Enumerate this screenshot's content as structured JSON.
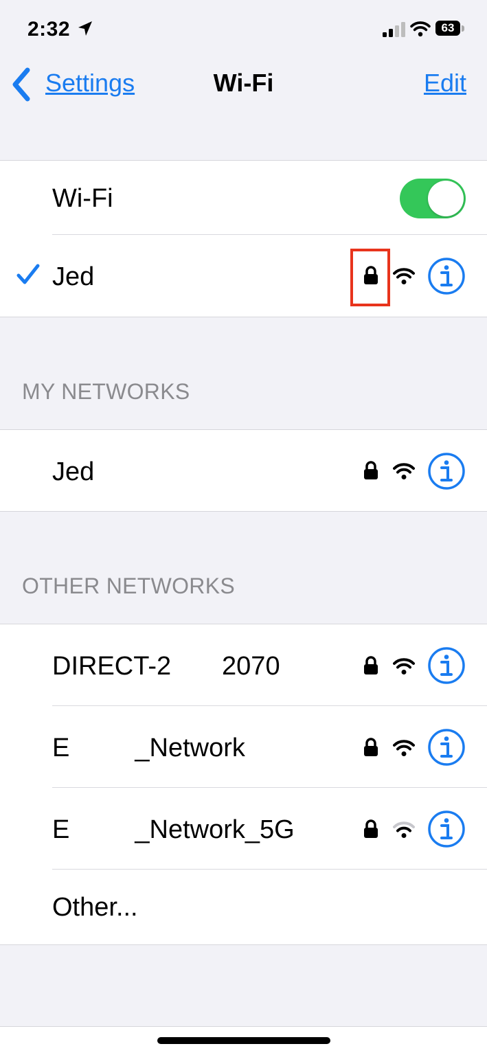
{
  "status_bar": {
    "time": "2:32",
    "battery": "63",
    "icons": [
      "location-arrow-icon",
      "cellular-signal-icon",
      "wifi-icon",
      "battery-icon"
    ]
  },
  "nav": {
    "back_label": "Settings",
    "title": "Wi-Fi",
    "edit_label": "Edit"
  },
  "wifi_toggle": {
    "label": "Wi-Fi",
    "on": true,
    "color": "#34c759"
  },
  "connected_network": {
    "name": "Jed",
    "secured": true,
    "signal": "full"
  },
  "my_networks": {
    "header": "MY NETWORKS",
    "items": [
      {
        "name": "Jed",
        "secured": true,
        "signal": "full"
      }
    ]
  },
  "other_networks": {
    "header": "OTHER NETWORKS",
    "items": [
      {
        "name": "DIRECT-2       2070",
        "secured": true,
        "signal": "full"
      },
      {
        "name": "E         _Network",
        "secured": true,
        "signal": "full"
      },
      {
        "name": "E         _Network_5G",
        "secured": true,
        "signal": "partial"
      }
    ],
    "other_label": "Other..."
  },
  "colors": {
    "accent": "#1a7cf0",
    "toggle_on": "#34c759",
    "highlight": "#e8341c",
    "background": "#f2f2f7"
  }
}
